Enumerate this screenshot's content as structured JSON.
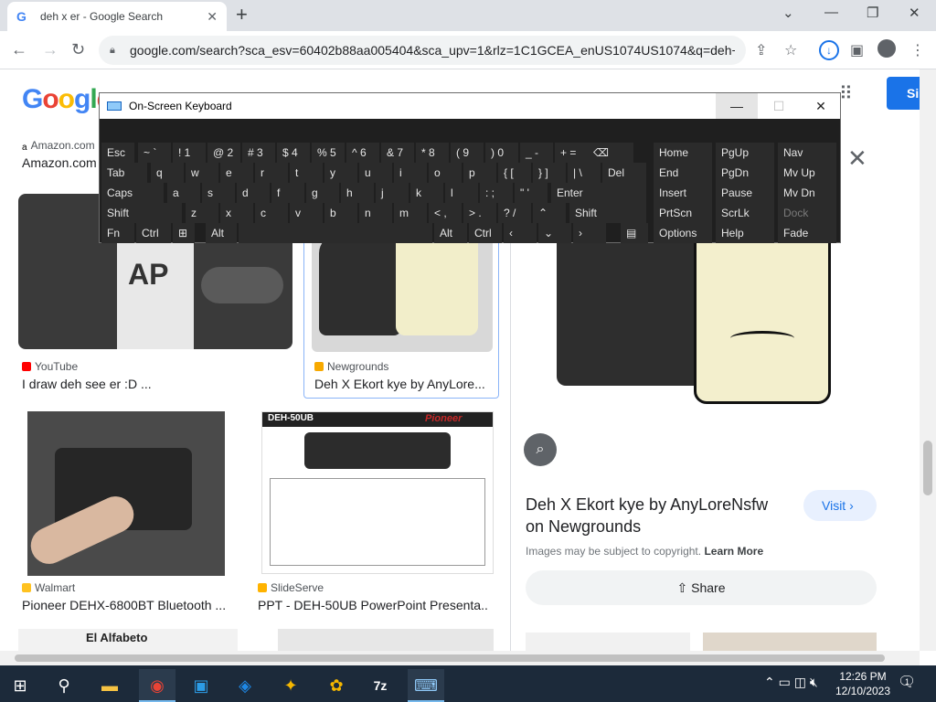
{
  "browser": {
    "tab_title": "deh x er - Google Search",
    "url": "google.com/search?sca_esv=60402b88aa005404&sca_upv=1&rlz=1C1GCEA_enUS1074US1074&q=deh+x..."
  },
  "page": {
    "logo": "Google",
    "signin_label": "Si",
    "results": [
      {
        "source": "Amazon.com",
        "caption": "Amazon.com"
      },
      {
        "source": "YouTube",
        "caption": "I draw deh see er :D ..."
      },
      {
        "source": "Newgrounds",
        "caption": "Deh X Ekort kye by AnyLore..."
      },
      {
        "source": "Walmart",
        "caption": "Pioneer DEHX-6800BT Bluetooth ..."
      },
      {
        "source": "SlideServe",
        "caption": "PPT - DEH-50UB PowerPoint Presenta..."
      }
    ],
    "bottom_caption": "El Alfabeto",
    "pioneer_model": "DEH-50UB",
    "pioneer_brand": "Pioneer",
    "preview": {
      "title": "Deh X Ekort kye by AnyLoreNsfw on Newgrounds",
      "visit_label": "Visit",
      "copyright_text": "Images may be subject to copyright.",
      "learn_more": "Learn More",
      "share_label": "Share"
    }
  },
  "osk": {
    "title": "On-Screen Keyboard",
    "row1": [
      "Esc",
      "~ `",
      "! 1",
      "@ 2",
      "# 3",
      "$ 4",
      "% 5",
      "^ 6",
      "& 7",
      "* 8",
      "( 9",
      ") 0",
      "_ -",
      "+ ="
    ],
    "row2": [
      "Tab",
      "q",
      "w",
      "e",
      "r",
      "t",
      "y",
      "u",
      "i",
      "o",
      "p",
      "{ [",
      "} ]",
      "| \\",
      "Del"
    ],
    "row3": [
      "Caps",
      "a",
      "s",
      "d",
      "f",
      "g",
      "h",
      "j",
      "k",
      "l",
      ": ;",
      "\" '",
      "Enter"
    ],
    "row4": [
      "Shift",
      "z",
      "x",
      "c",
      "v",
      "b",
      "n",
      "m",
      "< ,",
      "> .",
      "? /",
      "Shift"
    ],
    "row5": [
      "Fn",
      "Ctrl",
      "Alt",
      "Alt",
      "Ctrl"
    ],
    "nav": [
      [
        "Home",
        "PgUp",
        "Nav"
      ],
      [
        "End",
        "PgDn",
        "Mv Up"
      ],
      [
        "Insert",
        "Pause",
        "Mv Dn"
      ],
      [
        "PrtScn",
        "ScrLk",
        "Dock"
      ],
      [
        "Options",
        "Help",
        "Fade"
      ]
    ]
  },
  "taskbar": {
    "time": "12:26 PM",
    "date": "12/10/2023",
    "notification_count": "1"
  }
}
